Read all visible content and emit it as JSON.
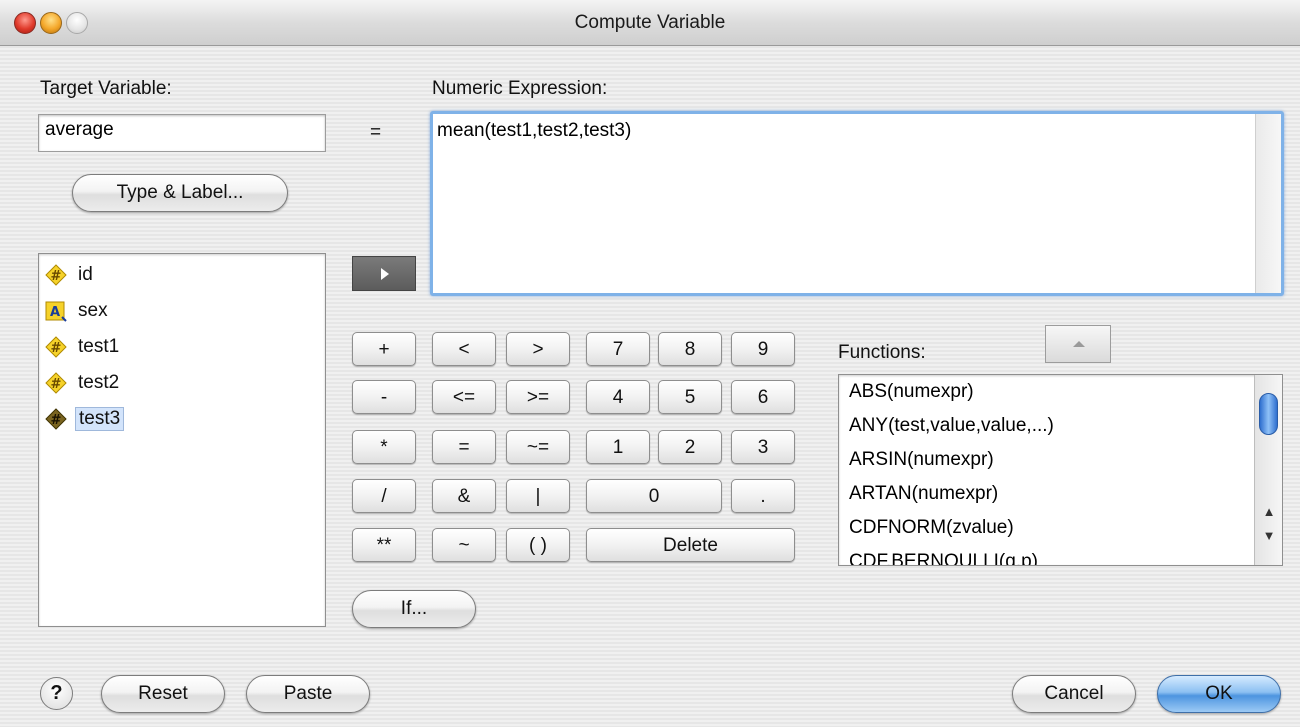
{
  "window": {
    "title": "Compute Variable"
  },
  "target": {
    "label": "Target Variable:",
    "value": "average"
  },
  "equals_sign": "=",
  "expression": {
    "label": "Numeric Expression:",
    "value": "mean(test1,test2,test3)"
  },
  "type_label_button": "Type & Label...",
  "variables": [
    {
      "label": "id",
      "icon": "numeric-variable-icon"
    },
    {
      "label": "sex",
      "icon": "string-variable-icon"
    },
    {
      "label": "test1",
      "icon": "numeric-variable-icon"
    },
    {
      "label": "test2",
      "icon": "numeric-variable-icon"
    },
    {
      "label": "test3",
      "icon": "numeric-variable-icon",
      "selected": true
    }
  ],
  "keypad": {
    "plus": "+",
    "lt": "<",
    "gt": ">",
    "seven": "7",
    "eight": "8",
    "nine": "9",
    "minus": "-",
    "le": "<=",
    "ge": ">=",
    "four": "4",
    "five": "5",
    "six": "6",
    "times": "*",
    "eq": "=",
    "ne": "~=",
    "one": "1",
    "two": "2",
    "three": "3",
    "divide": "/",
    "and": "&",
    "or": "|",
    "zero": "0",
    "dot": ".",
    "power": "**",
    "not": "~",
    "parens": "( )",
    "delete": "Delete"
  },
  "if_button": "If...",
  "functions": {
    "label": "Functions:",
    "items": [
      "ABS(numexpr)",
      "ANY(test,value,value,...)",
      "ARSIN(numexpr)",
      "ARTAN(numexpr)",
      "CDFNORM(zvalue)",
      "CDF.BERNOULLI(q,p)"
    ]
  },
  "footer": {
    "help": "?",
    "reset": "Reset",
    "paste": "Paste",
    "cancel": "Cancel",
    "ok": "OK"
  },
  "colors": {
    "accent": "#4d95e0",
    "focus_ring": "#7fb2e8",
    "selection": "#d3e4fb"
  }
}
